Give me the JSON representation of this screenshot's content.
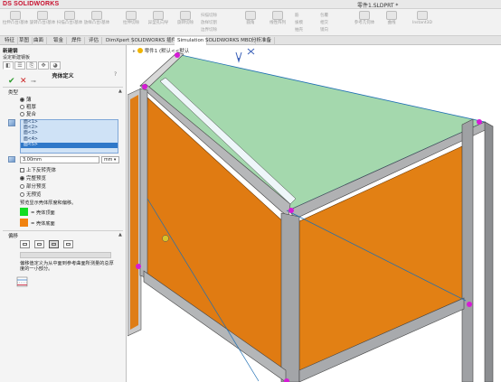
{
  "app": {
    "logo_text": "SOLIDWORKS",
    "document_title": "零件1.SLDPRT *"
  },
  "colors": {
    "brand_red": "#c8102e",
    "face_selected_green": "#9fd6a8",
    "face_orange": "#e07b12",
    "frame_gray": "#8f9195",
    "edge_magenta": "#d61bd6",
    "list_selection_blue": "#2f78c9",
    "inner_surface_green": "#11dd22",
    "outer_surface_orange": "#f0820f"
  },
  "command_bar": {
    "items": [
      {
        "label": "拉伸凸台/基体",
        "icon": "extrude-icon"
      },
      {
        "label": "旋转凸台/基体",
        "icon": "revolve-icon"
      },
      {
        "label": "扫描凸台/基体",
        "icon": "sweep-icon"
      },
      {
        "label": "放样凸台/基体",
        "icon": "loft-icon"
      },
      {
        "label": "拉伸切除",
        "icon": "extrude-cut-icon"
      },
      {
        "label": "异型孔向导",
        "icon": "hole-wizard-icon"
      },
      {
        "label": "旋转切除",
        "icon": "revolved-cut-icon"
      },
      {
        "label": "圆角",
        "icon": "fillet-icon"
      },
      {
        "label": "线性阵列",
        "icon": "linear-pattern-icon"
      },
      {
        "label": "筋",
        "icon": "rib-icon"
      },
      {
        "label": "拔模",
        "icon": "draft-icon"
      },
      {
        "label": "包覆",
        "icon": "wrap-icon"
      },
      {
        "label": "相交",
        "icon": "intersect-icon"
      },
      {
        "label": "参考几何体",
        "icon": "reference-geometry-icon"
      },
      {
        "label": "曲线",
        "icon": "curves-icon"
      },
      {
        "label": "Instant3D",
        "icon": "instant3d-icon"
      }
    ],
    "small_items": [
      "扫描切除",
      "放样切割",
      "边界切除",
      "抽壳",
      "镜向"
    ]
  },
  "tabs": [
    {
      "label": "特征",
      "active": false
    },
    {
      "label": "草图",
      "active": false
    },
    {
      "label": "曲面",
      "active": false
    },
    {
      "label": "钣金",
      "active": false
    },
    {
      "label": "焊件",
      "active": false
    },
    {
      "label": "评估",
      "active": false
    },
    {
      "label": "DimXpert",
      "active": false
    },
    {
      "label": "SOLIDWORKS 插件",
      "active": false
    },
    {
      "label": "Simulation",
      "active": true
    },
    {
      "label": "SOLIDWORKS MBD",
      "active": false
    },
    {
      "label": "分析准备",
      "active": false
    }
  ],
  "property_manager": {
    "header_title": "新建钢",
    "header_subtitle": "设定新建钢板",
    "feature_title": "壳体定义",
    "help_label": "?",
    "ok_label": "✔",
    "cancel_label": "✕",
    "pin_label": "⊸",
    "type_group": {
      "title": "类型",
      "options": [
        {
          "label": "薄",
          "selected": true
        },
        {
          "label": "粗厚",
          "selected": false
        },
        {
          "label": "复合",
          "selected": false
        }
      ]
    },
    "faces": [
      "面<1>",
      "面<2>",
      "面<3>",
      "面<4>",
      "面<5>"
    ],
    "selected_face_index": 4,
    "thickness": {
      "value": "3.00mm",
      "unit": "mm"
    },
    "flip_checkbox_label": "上下反转壳体",
    "preview_options": [
      {
        "label": "完整预览",
        "selected": true
      },
      {
        "label": "部分预览",
        "selected": false
      },
      {
        "label": "无预览",
        "selected": false
      }
    ],
    "preview_note": "预览显示壳体厚度和偏移。",
    "legend": [
      {
        "label": "= 壳体顶面",
        "color": "#11dd22"
      },
      {
        "label": "= 壳体底面",
        "color": "#f0820f"
      }
    ],
    "offset_group": {
      "title": "偏移",
      "help_text": "偏移值定义为从中面到参考曲面所测量的总厚度的一小部分。"
    }
  },
  "viewport": {
    "tree_label": "零件1 (默认<<默认"
  }
}
